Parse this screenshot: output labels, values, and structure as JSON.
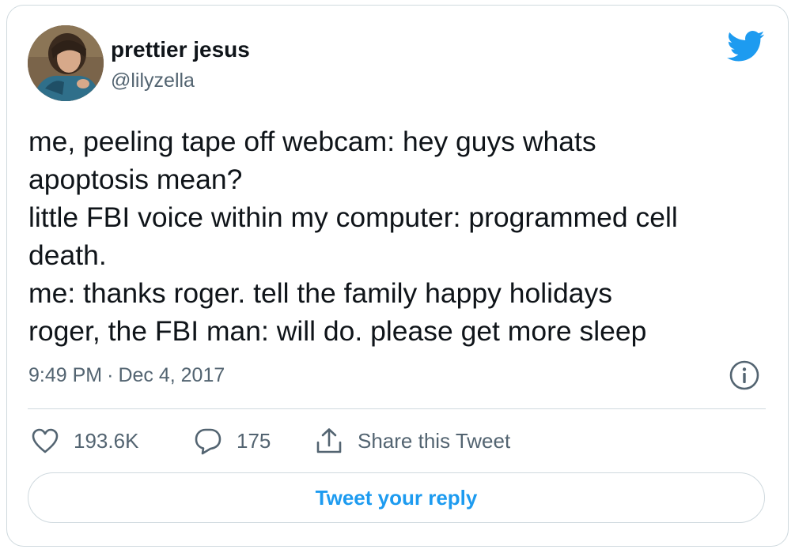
{
  "author": {
    "display_name": "prettier jesus",
    "handle": "@lilyzella"
  },
  "tweet": {
    "lines": [
      "me, peeling tape off webcam: hey guys whats",
      "apoptosis mean?",
      "little FBI voice within my computer: programmed cell",
      "death.",
      "me: thanks roger. tell the family happy holidays",
      "roger, the FBI man: will do. please get more sleep"
    ],
    "time": "9:49 PM",
    "separator": "·",
    "date": "Dec 4, 2017"
  },
  "actions": {
    "likes": "193.6K",
    "replies": "175",
    "share_label": "Share this Tweet",
    "reply_button_label": "Tweet your reply"
  },
  "icons": {
    "brand": "twitter-bird-icon",
    "info": "info-icon",
    "like": "heart-icon",
    "reply": "speech-bubble-icon",
    "share": "share-upload-icon"
  },
  "colors": {
    "brand_blue": "#1d9bf0",
    "text_primary": "#0f1419",
    "text_secondary": "#536471",
    "border": "#cfd9de"
  }
}
